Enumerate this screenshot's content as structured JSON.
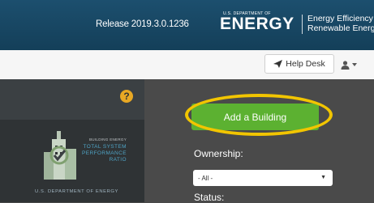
{
  "header": {
    "release": "Release 2019.3.0.1236",
    "doe_small": "U.S. DEPARTMENT OF",
    "doe_big": "ENERGY",
    "eere_line1": "Energy Efficiency &",
    "eere_line2": "Renewable Energy",
    "bg_color": "#1c4f6e"
  },
  "toolbar": {
    "help_desk_label": "Help Desk",
    "help_desk_icon": "paper-plane-icon",
    "user_icon": "user-icon"
  },
  "sidebar": {
    "help_icon_label": "?",
    "logo_line1": "BUILDING ENERGY",
    "logo_line2": "TOTAL SYSTEM",
    "logo_line3": "PERFORMANCE",
    "logo_line4": "RATIO",
    "logo_doe": "U.S. DEPARTMENT OF ENERGY"
  },
  "main": {
    "add_building_label": "Add a Building",
    "ownership_label": "Ownership:",
    "ownership_value": "- All -",
    "status_label": "Status:",
    "button_color": "#5cb131",
    "highlight_color": "#f2c500"
  }
}
